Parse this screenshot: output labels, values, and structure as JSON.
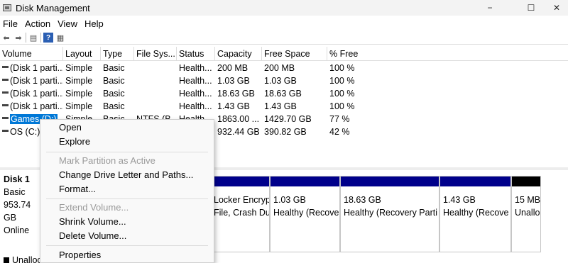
{
  "window": {
    "title": "Disk Management",
    "minimize": "−",
    "maximize": "☐",
    "close": "✕"
  },
  "menu": [
    "File",
    "Action",
    "View",
    "Help"
  ],
  "table": {
    "columns": [
      "Volume",
      "Layout",
      "Type",
      "File Sys...",
      "Status",
      "Capacity",
      "Free Space",
      "% Free"
    ],
    "rows": [
      {
        "volume": "(Disk 1 parti...",
        "layout": "Simple",
        "type": "Basic",
        "fs": "",
        "status": "Health...",
        "capacity": "200 MB",
        "free": "200 MB",
        "pct": "100 %"
      },
      {
        "volume": "(Disk 1 parti...",
        "layout": "Simple",
        "type": "Basic",
        "fs": "",
        "status": "Health...",
        "capacity": "1.03 GB",
        "free": "1.03 GB",
        "pct": "100 %"
      },
      {
        "volume": "(Disk 1 parti...",
        "layout": "Simple",
        "type": "Basic",
        "fs": "",
        "status": "Health...",
        "capacity": "18.63 GB",
        "free": "18.63 GB",
        "pct": "100 %"
      },
      {
        "volume": "(Disk 1 parti...",
        "layout": "Simple",
        "type": "Basic",
        "fs": "",
        "status": "Health...",
        "capacity": "1.43 GB",
        "free": "1.43 GB",
        "pct": "100 %"
      },
      {
        "volume": "Games (D:)",
        "layout": "Simple",
        "type": "Basic",
        "fs": "NTFS (B...",
        "status": "Health...",
        "capacity": "1863.00 ...",
        "free": "1429.70 GB",
        "pct": "77 %"
      },
      {
        "volume": "OS (C:)",
        "layout": "",
        "type": "",
        "fs": "",
        "status": "",
        "capacity": "932.44 GB",
        "free": "390.82 GB",
        "pct": "42 %"
      }
    ]
  },
  "disk": {
    "name": "Disk 1",
    "type": "Basic",
    "size": "953.74 GB",
    "status": "Online",
    "partitions": [
      {
        "line1": "",
        "line2": "Locker Encryp",
        "line3": "File, Crash Du"
      },
      {
        "line1": "1.03 GB",
        "line2": "Healthy (Recove",
        "line3": ""
      },
      {
        "line1": "18.63 GB",
        "line2": "Healthy (Recovery Parti",
        "line3": ""
      },
      {
        "line1": "1.43 GB",
        "line2": "Healthy (Recove",
        "line3": ""
      },
      {
        "line1": "15 MB",
        "line2": "Unallo",
        "line3": ""
      }
    ],
    "legend_unallocated": "Unalloca"
  },
  "context_menu": {
    "items": [
      {
        "label": "Open",
        "enabled": true
      },
      {
        "label": "Explore",
        "enabled": true
      },
      {
        "label": "Mark Partition as Active",
        "enabled": false
      },
      {
        "label": "Change Drive Letter and Paths...",
        "enabled": true
      },
      {
        "label": "Format...",
        "enabled": true
      },
      {
        "label": "Extend Volume...",
        "enabled": false
      },
      {
        "label": "Shrink Volume...",
        "enabled": true
      },
      {
        "label": "Delete Volume...",
        "enabled": true
      },
      {
        "label": "Properties",
        "enabled": true
      }
    ]
  },
  "colors": {
    "selection": "#0078d7",
    "partition_bar": "#00008b",
    "unallocated_bar": "#000000",
    "disabled_text": "#9a9a9a"
  }
}
